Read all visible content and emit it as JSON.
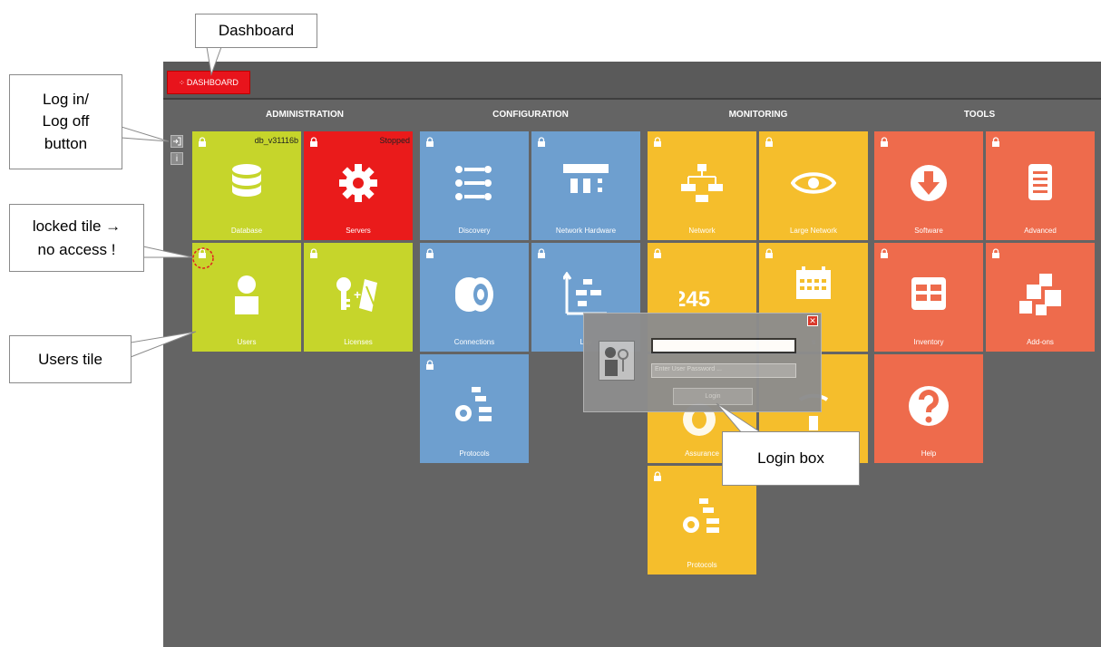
{
  "callouts": {
    "dashboard": "Dashboard",
    "login_logoff_1": "Log in/",
    "login_logoff_2": "Log off",
    "login_logoff_3": "button",
    "locked_1": "locked tile →",
    "locked_2": "no access !",
    "users_tile": "Users tile",
    "login_box": "Login box"
  },
  "topbar": {
    "tab_label": "DASHBOARD"
  },
  "sections": [
    "ADMINISTRATION",
    "CONFIGURATION",
    "MONITORING",
    "TOOLS"
  ],
  "tiles": {
    "database": {
      "label": "Database",
      "status": "db_v31116b"
    },
    "servers": {
      "label": "Servers",
      "status": "Stopped"
    },
    "users": {
      "label": "Users"
    },
    "licenses": {
      "label": "Licenses"
    },
    "discovery": {
      "label": "Discovery"
    },
    "network_hardware": {
      "label": "Network Hardware"
    },
    "connections": {
      "label": "Connections"
    },
    "layers": {
      "label": "Lay"
    },
    "protocols_config": {
      "label": "Protocols"
    },
    "network": {
      "label": "Network"
    },
    "large_network": {
      "label": "Large Network"
    },
    "counters": {
      "label": ""
    },
    "schedule": {
      "label": "s"
    },
    "assurance": {
      "label": "Assurance"
    },
    "monitor_extra": {
      "label": ""
    },
    "protocols_monitor": {
      "label": "Protocols"
    },
    "software": {
      "label": "Software"
    },
    "advanced": {
      "label": "Advanced"
    },
    "inventory": {
      "label": "Inventory"
    },
    "addons": {
      "label": "Add-ons"
    },
    "help": {
      "label": "Help"
    }
  },
  "login": {
    "username_value": "",
    "password_placeholder": "Enter User Password ...",
    "button_label": "Login"
  },
  "colors": {
    "admin": "#c6d52b",
    "servers": "#ea1b1b",
    "config": "#6e9fcf",
    "monitor": "#f5be2c",
    "tools": "#ee6b4c"
  }
}
